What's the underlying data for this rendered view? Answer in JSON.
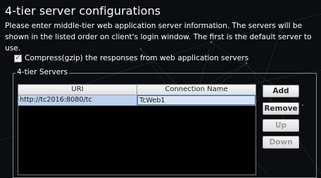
{
  "title": "4-tier server configurations",
  "description": "Please enter middle-tier web application server information. The servers will be shown in the listed order on client's login window. The first is the default server to use.",
  "compress": {
    "checked": true,
    "label": "Compress(gzip) the responses from web application servers"
  },
  "servers_group": {
    "label": "4-tier Servers",
    "columns": [
      "URI",
      "Connection Name"
    ],
    "rows": [
      {
        "uri": "http://tc2016:8080/tc",
        "connection_name": "TcWeb1"
      }
    ]
  },
  "buttons": {
    "add": "Add",
    "remove": "Remove",
    "up": "Up",
    "down": "Down"
  },
  "colors": {
    "background": "#0b0d11",
    "selected_row": "#bcd1ec",
    "text": "#ffffff"
  }
}
